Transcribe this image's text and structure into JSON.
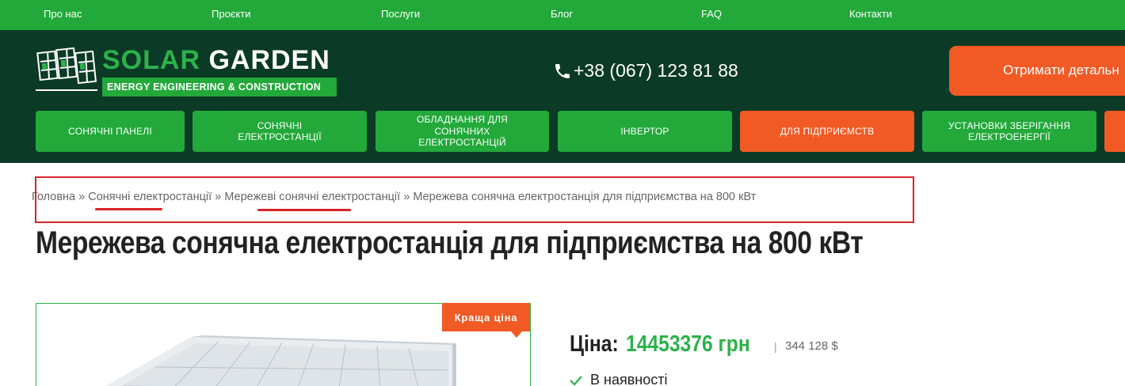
{
  "topnav": {
    "items": [
      "Про нас",
      "Проєкти",
      "Послуги",
      "Блог",
      "FAQ",
      "Контакти"
    ]
  },
  "header": {
    "logo_word1": "SOLAR",
    "logo_word2": "GARDEN",
    "logo_tagline": "ENERGY ENGINEERING & CONSTRUCTION",
    "phone": "+38 (067) 123 81 88",
    "cta_label": "Отримати детальн"
  },
  "catnav": {
    "items": [
      "СОНЯЧНІ ПАНЕЛІ",
      "СОНЯЧНІ\nЕЛЕКТРОСТАНЦІЇ",
      "ОБЛАДНАННЯ ДЛЯ\nСОНЯЧНИХ\nЕЛЕКТРОСТАНЦІЙ",
      "ІНВЕРТОР",
      "ДЛЯ ПІДПРИЄМСТВ",
      "УСТАНОВКИ ЗБЕРІГАННЯ\nЕЛЕКТРОЕНЕРГІЇ"
    ]
  },
  "breadcrumb": {
    "home": "Головна",
    "sep": " » ",
    "level1": "Сонячні електростанції",
    "level2": "Мережеві сонячні електростанції",
    "current": "Мережева сонячна електростанція для підприємства на 800 кВт"
  },
  "product": {
    "title": "Мережева сонячна електростанція для підприємства на 800 кВт",
    "badge": "Краща ціна",
    "price_label": "Ціна:",
    "price_value": "14453376 грн",
    "price_sep": "|",
    "price_usd": "344 128 $",
    "stock": "В наявності"
  },
  "colors": {
    "brand_green": "#22a93a",
    "header_dark": "#0b3a26",
    "accent_orange": "#f15a24",
    "highlight_red": "#d8232a"
  }
}
